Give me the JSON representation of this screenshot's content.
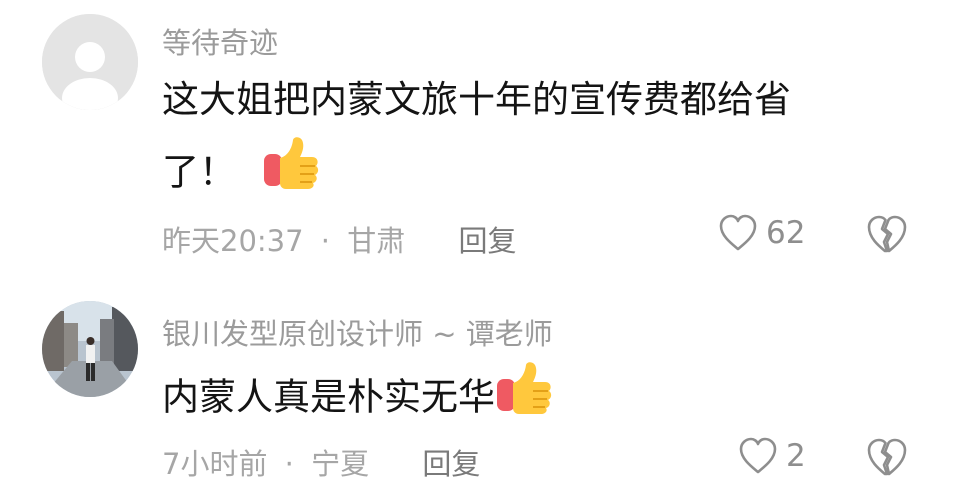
{
  "comments": [
    {
      "username": "等待奇迹",
      "text_line1": "这大姐把内蒙文旅十年的宣传费都给省",
      "text_line2": "了！",
      "time": "昨天20:37",
      "location": "甘肃",
      "separator": "·",
      "reply_label": "回复",
      "likes": "62",
      "emoji": "thumbs-up-emoji"
    },
    {
      "username": "银川发型原创设计师 ~ 谭老师",
      "text_line1": "内蒙人真是朴实无华",
      "time": "7小时前",
      "location": "宁夏",
      "separator": "·",
      "reply_label": "回复",
      "likes": "2",
      "emoji": "thumbs-up-emoji"
    }
  ],
  "icons": {
    "like": "heart-outline-icon",
    "dislike": "broken-heart-icon"
  },
  "colors": {
    "username": "#9b9b9b",
    "text": "#141414",
    "meta": "#a6a6a6",
    "icon": "#8e8e8e"
  }
}
